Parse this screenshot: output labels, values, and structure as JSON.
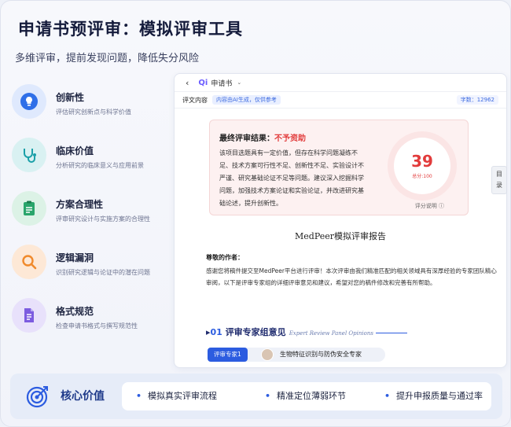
{
  "header": {
    "title": "申请书预评审：模拟评审工具",
    "subtitle": "多维评审，提前发现问题，降低失分风险"
  },
  "features": [
    {
      "title": "创新性",
      "desc": "评估研究创新点与科学价值",
      "icon": "lightbulb-icon",
      "color": "#2f6fe8"
    },
    {
      "title": "临床价值",
      "desc": "分析研究的临床意义与应用前景",
      "icon": "stethoscope-icon",
      "color": "#1aa0a8"
    },
    {
      "title": "方案合理性",
      "desc": "评审研究设计与实施方案的合理性",
      "icon": "clipboard-icon",
      "color": "#29a56b"
    },
    {
      "title": "逻辑漏洞",
      "desc": "识别研究逻辑与论证中的潜在问题",
      "icon": "magnifier-icon",
      "color": "#f08a2c"
    },
    {
      "title": "格式规范",
      "desc": "检查申请书格式与撰写规范性",
      "icon": "document-icon",
      "color": "#7c5ce0"
    }
  ],
  "panel": {
    "back": "‹",
    "app_logo": "Qi",
    "doc_name": "申请书",
    "chevron": "⌄",
    "content_label": "评文内容",
    "ai_tag": "内容由AI生成，仅供参考",
    "word_count": "字数：12962",
    "result_title_prefix": "最终评审结果：",
    "result_status": "不予资助",
    "result_body": "该项目选题具有一定价值，但存在科学问题凝练不足、技术方案可行性不足、创新性不足、实验设计不严谨、研究基础论证不足等问题。建议深入挖掘科学问题，加强技术方案论证和实验论证，并改进研究基础论述，提升创新性。",
    "score": "39",
    "score_label": "总分:100",
    "score_note": "评分说明 ⓘ",
    "report_title": "MedPeer模拟评审报告",
    "greeting": "尊敬的作者：",
    "intro": "感谢您将稿件提交至MedPeer平台进行评审！本次评审由我们精准匹配的相关领域具有深厚经验的专家团队精心审阅，以下是评审专家组的详细评审意见和建议，希望对您的稿件修改和完善有所帮助。",
    "section_num": "01",
    "section_title": "评审专家组意见",
    "section_en": "Expert Review Panel Opinions",
    "expert_badge": "评审专家1",
    "expert_name": "生物特征识别与防伪安全专家",
    "toc": "目\n录"
  },
  "bottom": {
    "label": "核心价值",
    "items": [
      "模拟真实评审流程",
      "精准定位薄弱环节",
      "提升申报质量与通过率"
    ],
    "accent": "#2c5ce0"
  }
}
